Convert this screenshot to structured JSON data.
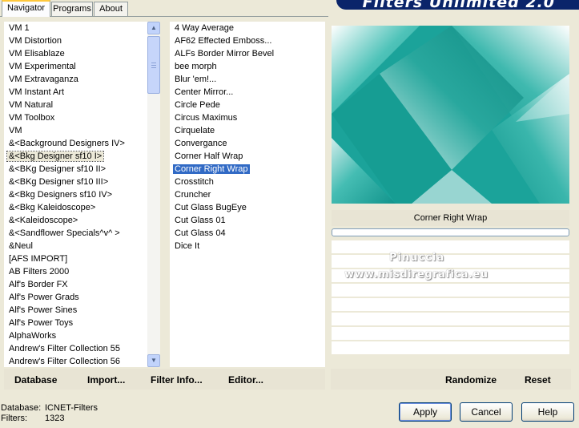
{
  "tabs": [
    "Navigator",
    "Programs",
    "About"
  ],
  "banner_title": "Filters Unlimited 2.0",
  "categories": [
    "VM 1",
    "VM Distortion",
    "VM Elisablaze",
    "VM Experimental",
    "VM Extravaganza",
    "VM Instant Art",
    "VM Natural",
    "VM Toolbox",
    "VM",
    "&<Background Designers IV>",
    "&<Bkg Designer sf10 I>",
    "&<BKg Designer sf10 II>",
    "&<BKg Designer sf10 III>",
    "&<Bkg Designers sf10 IV>",
    "&<Bkg Kaleidoscope>",
    "&<Kaleidoscope>",
    "&<Sandflower Specials^v^ >",
    "&Neul",
    "[AFS IMPORT]",
    "AB Filters 2000",
    "Alf's Border FX",
    "Alf's Power Grads",
    "Alf's Power Sines",
    "Alf's Power Toys",
    "AlphaWorks",
    "Andrew's Filter Collection 55",
    "Andrew's Filter Collection 56"
  ],
  "selected_category": "&<Bkg Designer sf10 I>",
  "filters": [
    "4 Way Average",
    "AF62 Effected Emboss...",
    "ALFs Border Mirror Bevel",
    "bee morph",
    "Blur 'em!...",
    "Center Mirror...",
    "Circle Pede",
    "Circus Maximus",
    "Cirquelate",
    "Convergance",
    "Corner Half Wrap",
    "Corner Right Wrap",
    "Crosstitch",
    "Cruncher",
    "Cut Glass  BugEye",
    "Cut Glass 01",
    "Cut Glass 04",
    "Dice It"
  ],
  "selected_filter": "Corner Right Wrap",
  "preview_filter_name": "Corner Right Wrap",
  "watermark": {
    "line1": "Pinuccia",
    "line2": "www.misdiregrafica.eu"
  },
  "left_actions": [
    "Database",
    "Import...",
    "Filter Info...",
    "Editor..."
  ],
  "right_actions": [
    "Randomize",
    "Reset"
  ],
  "info": {
    "database_label": "Database:",
    "database_value": "ICNET-Filters",
    "filters_label": "Filters:",
    "filters_value": "1323"
  },
  "buttons": {
    "apply": "Apply",
    "cancel": "Cancel",
    "help": "Help"
  },
  "colors": {
    "preview_teal": "#1ba39a",
    "selection": "#316ac5",
    "banner": "#0a246a"
  }
}
